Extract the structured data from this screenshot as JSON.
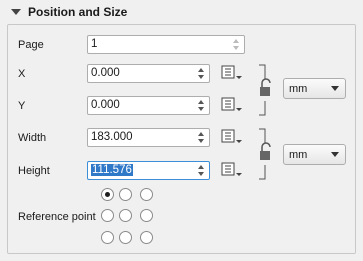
{
  "section": {
    "title": "Position and Size"
  },
  "page": {
    "label": "Page",
    "value": "1"
  },
  "x": {
    "label": "X",
    "value": "0.000"
  },
  "y": {
    "label": "Y",
    "value": "0.000"
  },
  "width": {
    "label": "Width",
    "value": "183.000"
  },
  "height": {
    "label": "Height",
    "value": "111.576"
  },
  "position_units": {
    "selected": "mm"
  },
  "size_units": {
    "selected": "mm"
  },
  "reference_point": {
    "label": "Reference point",
    "selected_index": 0
  }
}
